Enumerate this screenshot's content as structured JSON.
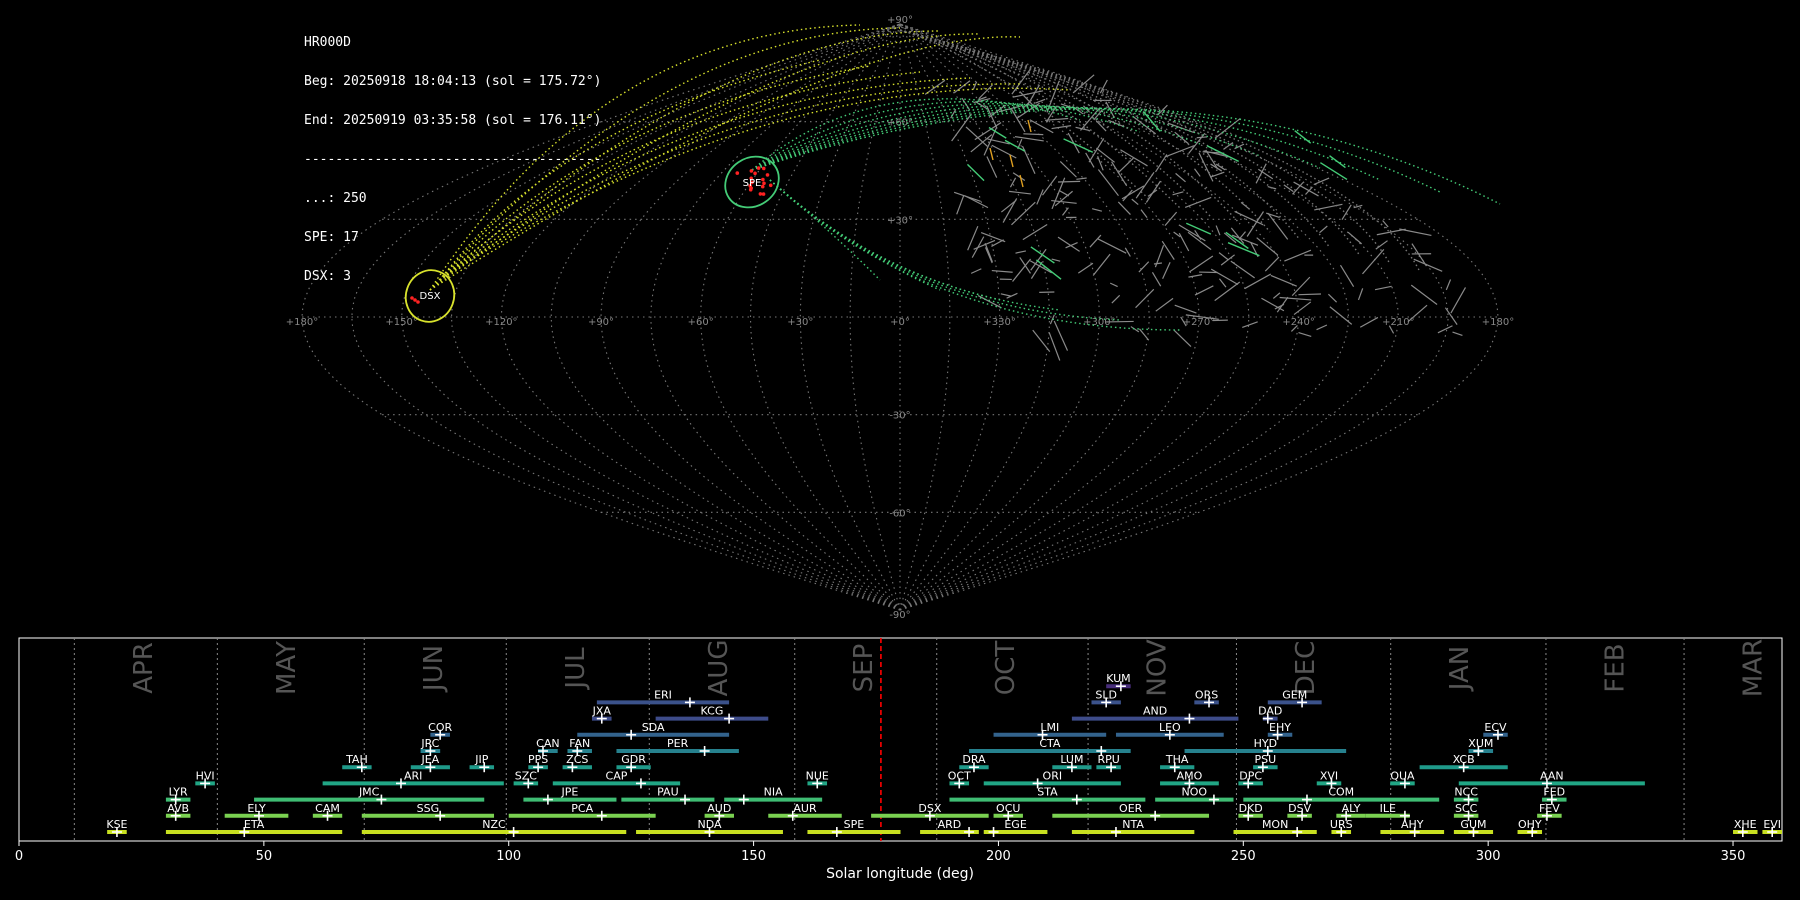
{
  "header": {
    "station": "HR000D",
    "beg": "Beg: 20250918 18:04:13 (sol = 175.72°)",
    "end": "End: 20250919 03:35:58 (sol = 176.11°)",
    "separator": "--------------------------------------",
    "counts": [
      "...: 250",
      "SPE: 17",
      "DSX: 3"
    ]
  },
  "sky_map": {
    "projection": "sinusoidal",
    "lon_labels": [
      "+180°",
      "+150°",
      "+120°",
      "+90°",
      "+60°",
      "+30°",
      "+0°",
      "+330°",
      "+300°",
      "+270°",
      "+240°",
      "+210°",
      "+180°"
    ],
    "lat_labels": [
      "+90°",
      "+60°",
      "+30°",
      "-30°",
      "-60°",
      "-90°"
    ],
    "showers": [
      {
        "code": "SPE",
        "color": "#33bb77",
        "lon": 45,
        "lat": 39,
        "count": 17
      },
      {
        "code": "DSX",
        "color": "#d8e22c",
        "lon": 138,
        "lat": 4,
        "count": 3
      }
    ],
    "colors": {
      "sporadic": "#777777",
      "grid": "#777777",
      "spe": "#44cc77",
      "dsx": "#d8e22c",
      "radiant": "#ff2222"
    }
  },
  "chart_data": {
    "type": "gantt",
    "xlabel": "Solar longitude (deg)",
    "xlim": [
      0,
      360
    ],
    "xticks": [
      0,
      50,
      100,
      150,
      200,
      250,
      300,
      350
    ],
    "current_sol": 176,
    "current_color": "#ff0000",
    "months": [
      {
        "label": "APR",
        "start": 11.3
      },
      {
        "label": "MAY",
        "start": 40.5
      },
      {
        "label": "JUN",
        "start": 70.5
      },
      {
        "label": "JUL",
        "start": 99.5
      },
      {
        "label": "AUG",
        "start": 128.7
      },
      {
        "label": "SEP",
        "start": 158.4
      },
      {
        "label": "OCT",
        "start": 187.4
      },
      {
        "label": "NOV",
        "start": 218.3
      },
      {
        "label": "DEC",
        "start": 248.6
      },
      {
        "label": "JAN",
        "start": 280.1
      },
      {
        "label": "FEB",
        "start": 311.8
      },
      {
        "label": "MAR",
        "start": 340.0
      }
    ],
    "showers": [
      {
        "code": "KUM",
        "row": 9,
        "start": 222,
        "end": 227,
        "peak": 225,
        "color": "#472d7b"
      },
      {
        "code": "SLD",
        "row": 8,
        "start": 219,
        "end": 225,
        "peak": 222,
        "color": "#3b528b"
      },
      {
        "code": "ORS",
        "row": 8,
        "start": 240,
        "end": 245,
        "peak": 243,
        "color": "#3b528b"
      },
      {
        "code": "GEM",
        "row": 8,
        "start": 255,
        "end": 266,
        "peak": 262,
        "color": "#3b528b"
      },
      {
        "code": "ERI",
        "row": 8,
        "start": 118,
        "end": 145,
        "peak": 137,
        "color": "#3b528b"
      },
      {
        "code": "JXA",
        "row": 7,
        "start": 117,
        "end": 121,
        "peak": 119,
        "color": "#3e4c8a"
      },
      {
        "code": "KCG",
        "row": 7,
        "start": 130,
        "end": 153,
        "peak": 145,
        "color": "#3e4c8a"
      },
      {
        "code": "AND",
        "row": 7,
        "start": 215,
        "end": 249,
        "peak": 239,
        "color": "#3e4c8a"
      },
      {
        "code": "DAD",
        "row": 7,
        "start": 254,
        "end": 257,
        "peak": 255,
        "color": "#3e4c8a"
      },
      {
        "code": "COR",
        "row": 6,
        "start": 84,
        "end": 88,
        "peak": 86,
        "color": "#33638d"
      },
      {
        "code": "SDA",
        "row": 6,
        "start": 114,
        "end": 145,
        "peak": 125,
        "color": "#33638d"
      },
      {
        "code": "LMI",
        "row": 6,
        "start": 199,
        "end": 222,
        "peak": 209,
        "color": "#33638d"
      },
      {
        "code": "LEO",
        "row": 6,
        "start": 224,
        "end": 246,
        "peak": 235,
        "color": "#33638d"
      },
      {
        "code": "EHY",
        "row": 6,
        "start": 255,
        "end": 260,
        "peak": 257,
        "color": "#33638d"
      },
      {
        "code": "ECV",
        "row": 6,
        "start": 299,
        "end": 304,
        "peak": 302,
        "color": "#33638d"
      },
      {
        "code": "JRC",
        "row": 5,
        "start": 82,
        "end": 86,
        "peak": 84,
        "color": "#26818e"
      },
      {
        "code": "CAN",
        "row": 5,
        "start": 106,
        "end": 110,
        "peak": 107,
        "color": "#26818e"
      },
      {
        "code": "FAN",
        "row": 5,
        "start": 112,
        "end": 117,
        "peak": 114,
        "color": "#26818e"
      },
      {
        "code": "PER",
        "row": 5,
        "start": 122,
        "end": 147,
        "peak": 140,
        "color": "#26818e"
      },
      {
        "code": "CTA",
        "row": 5,
        "start": 194,
        "end": 227,
        "peak": 221,
        "color": "#26818e"
      },
      {
        "code": "HYD",
        "row": 5,
        "start": 238,
        "end": 271,
        "peak": 255,
        "color": "#26818e"
      },
      {
        "code": "XUM",
        "row": 5,
        "start": 296,
        "end": 301,
        "peak": 298,
        "color": "#26818e"
      },
      {
        "code": "TAH",
        "row": 4,
        "start": 66,
        "end": 72,
        "peak": 70,
        "color": "#1f9a8a"
      },
      {
        "code": "JEA",
        "row": 4,
        "start": 80,
        "end": 88,
        "peak": 84,
        "color": "#1f9a8a"
      },
      {
        "code": "JIP",
        "row": 4,
        "start": 92,
        "end": 97,
        "peak": 95,
        "color": "#1f9a8a"
      },
      {
        "code": "PPS",
        "row": 4,
        "start": 104,
        "end": 108,
        "peak": 106,
        "color": "#1f9a8a"
      },
      {
        "code": "ZCS",
        "row": 4,
        "start": 111,
        "end": 117,
        "peak": 113,
        "color": "#1f9a8a"
      },
      {
        "code": "GDR",
        "row": 4,
        "start": 122,
        "end": 129,
        "peak": 125,
        "color": "#1f9a8a"
      },
      {
        "code": "DRA",
        "row": 4,
        "start": 192,
        "end": 198,
        "peak": 195,
        "color": "#1f9a8a"
      },
      {
        "code": "LUM",
        "row": 4,
        "start": 211,
        "end": 219,
        "peak": 215,
        "color": "#1f9a8a"
      },
      {
        "code": "RPU",
        "row": 4,
        "start": 220,
        "end": 225,
        "peak": 223,
        "color": "#1f9a8a"
      },
      {
        "code": "THA",
        "row": 4,
        "start": 233,
        "end": 240,
        "peak": 236,
        "color": "#1f9a8a"
      },
      {
        "code": "PSU",
        "row": 4,
        "start": 252,
        "end": 257,
        "peak": 254,
        "color": "#1f9a8a"
      },
      {
        "code": "XCB",
        "row": 4,
        "start": 286,
        "end": 304,
        "peak": 295,
        "color": "#1f9a8a"
      },
      {
        "code": "HVI",
        "row": 3,
        "start": 36,
        "end": 40,
        "peak": 38,
        "color": "#21a685"
      },
      {
        "code": "ARI",
        "row": 3,
        "start": 62,
        "end": 99,
        "peak": 78,
        "color": "#21a685"
      },
      {
        "code": "SZC",
        "row": 3,
        "start": 101,
        "end": 106,
        "peak": 104,
        "color": "#21a685"
      },
      {
        "code": "CAP",
        "row": 3,
        "start": 109,
        "end": 135,
        "peak": 127,
        "color": "#21a685"
      },
      {
        "code": "NUE",
        "row": 3,
        "start": 161,
        "end": 165,
        "peak": 163,
        "color": "#21a685"
      },
      {
        "code": "OCT",
        "row": 3,
        "start": 190,
        "end": 194,
        "peak": 192,
        "color": "#21a685"
      },
      {
        "code": "ORI",
        "row": 3,
        "start": 197,
        "end": 225,
        "peak": 208,
        "color": "#21a685"
      },
      {
        "code": "AMO",
        "row": 3,
        "start": 233,
        "end": 245,
        "peak": 239,
        "color": "#21a685"
      },
      {
        "code": "DPC",
        "row": 3,
        "start": 249,
        "end": 254,
        "peak": 251,
        "color": "#21a685"
      },
      {
        "code": "XVI",
        "row": 3,
        "start": 265,
        "end": 270,
        "peak": 268,
        "color": "#21a685"
      },
      {
        "code": "QUA",
        "row": 3,
        "start": 280,
        "end": 285,
        "peak": 283,
        "color": "#21a685"
      },
      {
        "code": "AAN",
        "row": 3,
        "start": 294,
        "end": 332,
        "peak": 312,
        "color": "#21a685"
      },
      {
        "code": "LYR",
        "row": 2,
        "start": 30,
        "end": 35,
        "peak": 32,
        "color": "#3fbc73"
      },
      {
        "code": "JMC",
        "row": 2,
        "start": 48,
        "end": 95,
        "peak": 74,
        "color": "#3fbc73"
      },
      {
        "code": "JPE",
        "row": 2,
        "start": 103,
        "end": 122,
        "peak": 108,
        "color": "#3fbc73"
      },
      {
        "code": "PAU",
        "row": 2,
        "start": 123,
        "end": 142,
        "peak": 136,
        "color": "#3fbc73"
      },
      {
        "code": "NIA",
        "row": 2,
        "start": 144,
        "end": 164,
        "peak": 148,
        "color": "#3fbc73"
      },
      {
        "code": "STA",
        "row": 2,
        "start": 190,
        "end": 230,
        "peak": 216,
        "color": "#3fbc73"
      },
      {
        "code": "NOO",
        "row": 2,
        "start": 232,
        "end": 248,
        "peak": 244,
        "color": "#3fbc73"
      },
      {
        "code": "COM",
        "row": 2,
        "start": 250,
        "end": 290,
        "peak": 263,
        "color": "#3fbc73"
      },
      {
        "code": "NCC",
        "row": 2,
        "start": 293,
        "end": 298,
        "peak": 296,
        "color": "#3fbc73"
      },
      {
        "code": "FED",
        "row": 2,
        "start": 311,
        "end": 316,
        "peak": 313,
        "color": "#3fbc73"
      },
      {
        "code": "AVB",
        "row": 1,
        "start": 30,
        "end": 35,
        "peak": 32,
        "color": "#7ad151"
      },
      {
        "code": "ELY",
        "row": 1,
        "start": 42,
        "end": 55,
        "peak": 49,
        "color": "#7ad151"
      },
      {
        "code": "CAM",
        "row": 1,
        "start": 60,
        "end": 66,
        "peak": 63,
        "color": "#7ad151"
      },
      {
        "code": "SSG",
        "row": 1,
        "start": 70,
        "end": 97,
        "peak": 86,
        "color": "#7ad151"
      },
      {
        "code": "PCA",
        "row": 1,
        "start": 100,
        "end": 130,
        "peak": 119,
        "color": "#7ad151"
      },
      {
        "code": "AUD",
        "row": 1,
        "start": 140,
        "end": 146,
        "peak": 143,
        "color": "#7ad151"
      },
      {
        "code": "AUR",
        "row": 1,
        "start": 153,
        "end": 168,
        "peak": 158,
        "color": "#7ad151"
      },
      {
        "code": "DSX",
        "row": 1,
        "start": 174,
        "end": 198,
        "peak": 186,
        "color": "#7ad151"
      },
      {
        "code": "OCU",
        "row": 1,
        "start": 199,
        "end": 205,
        "peak": 202,
        "color": "#7ad151"
      },
      {
        "code": "OER",
        "row": 1,
        "start": 211,
        "end": 243,
        "peak": 232,
        "color": "#7ad151"
      },
      {
        "code": "DKD",
        "row": 1,
        "start": 249,
        "end": 254,
        "peak": 251,
        "color": "#7ad151"
      },
      {
        "code": "DSV",
        "row": 1,
        "start": 259,
        "end": 264,
        "peak": 262,
        "color": "#7ad151"
      },
      {
        "code": "ALY",
        "row": 1,
        "start": 269,
        "end": 275,
        "peak": 271,
        "color": "#7ad151"
      },
      {
        "code": "ILE",
        "row": 1,
        "start": 275,
        "end": 284,
        "peak": 283,
        "color": "#7ad151"
      },
      {
        "code": "SCC",
        "row": 1,
        "start": 293,
        "end": 298,
        "peak": 296,
        "color": "#7ad151"
      },
      {
        "code": "FEV",
        "row": 1,
        "start": 310,
        "end": 315,
        "peak": 312,
        "color": "#7ad151"
      },
      {
        "code": "KSE",
        "row": 0,
        "start": 18,
        "end": 22,
        "peak": 20,
        "color": "#c8e020"
      },
      {
        "code": "ETA",
        "row": 0,
        "start": 30,
        "end": 66,
        "peak": 46,
        "color": "#c8e020"
      },
      {
        "code": "NZC",
        "row": 0,
        "start": 70,
        "end": 124,
        "peak": 101,
        "color": "#c8e020"
      },
      {
        "code": "NDA",
        "row": 0,
        "start": 126,
        "end": 156,
        "peak": 141,
        "color": "#c8e020"
      },
      {
        "code": "SPE",
        "row": 0,
        "start": 161,
        "end": 180,
        "peak": 167,
        "color": "#c8e020"
      },
      {
        "code": "ARD",
        "row": 0,
        "start": 184,
        "end": 196,
        "peak": 194,
        "color": "#c8e020"
      },
      {
        "code": "EGE",
        "row": 0,
        "start": 197,
        "end": 210,
        "peak": 199,
        "color": "#c8e020"
      },
      {
        "code": "NTA",
        "row": 0,
        "start": 215,
        "end": 240,
        "peak": 224,
        "color": "#c8e020"
      },
      {
        "code": "MON",
        "row": 0,
        "start": 248,
        "end": 265,
        "peak": 261,
        "color": "#c8e020"
      },
      {
        "code": "URS",
        "row": 0,
        "start": 268,
        "end": 272,
        "peak": 270,
        "color": "#c8e020"
      },
      {
        "code": "AHY",
        "row": 0,
        "start": 278,
        "end": 291,
        "peak": 285,
        "color": "#c8e020"
      },
      {
        "code": "GUM",
        "row": 0,
        "start": 293,
        "end": 301,
        "peak": 297,
        "color": "#c8e020"
      },
      {
        "code": "OHY",
        "row": 0,
        "start": 306,
        "end": 311,
        "peak": 309,
        "color": "#c8e020"
      },
      {
        "code": "XHE",
        "row": 0,
        "start": 350,
        "end": 355,
        "peak": 352,
        "color": "#c8e020"
      },
      {
        "code": "EVI",
        "row": 0,
        "start": 356,
        "end": 360,
        "peak": 358,
        "color": "#c8e020"
      }
    ]
  }
}
